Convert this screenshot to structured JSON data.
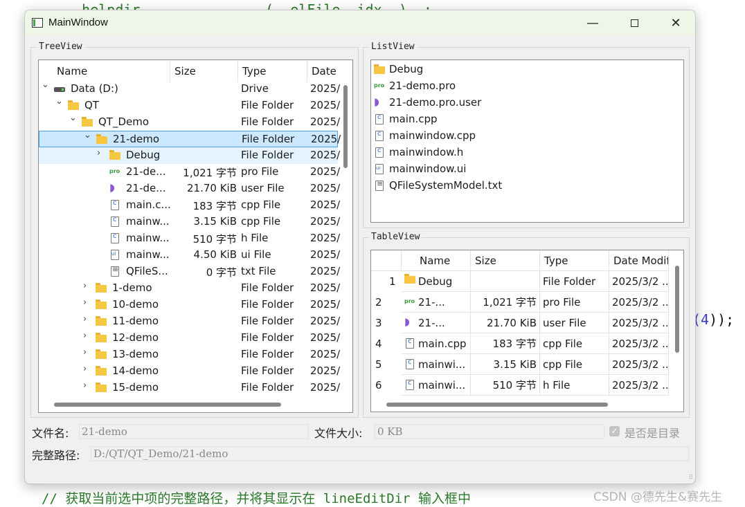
{
  "background": {
    "code_top": "    helpdir               (  elFile  idx  )  ;",
    "code_right_num": "(4",
    "code_right_rest": "));",
    "comment": "// 获取当前选中项的完整路径，并将其显示在 lineEditDir 输入框中",
    "watermark": "CSDN @德先生&赛先生"
  },
  "window": {
    "title": "MainWindow",
    "min_glyph": "—",
    "close_glyph": "✕"
  },
  "tree": {
    "group_title": "TreeView",
    "headers": [
      "Name",
      "Size",
      "Type",
      "Date"
    ],
    "rows": [
      {
        "name": "Data (D:)",
        "size": "",
        "type": "Drive",
        "date": "2025/",
        "chevron": "⌄",
        "icon": "drive-icon"
      },
      {
        "name": "QT",
        "size": "",
        "type": "File Folder",
        "date": "2025/",
        "chevron": "⌄",
        "icon": "folder-icon"
      },
      {
        "name": "QT_Demo",
        "size": "",
        "type": "File Folder",
        "date": "2025/",
        "chevron": "⌄",
        "icon": "folder-icon"
      },
      {
        "name": "21-demo",
        "size": "",
        "type": "File Folder",
        "date": "2025/",
        "chevron": "⌄",
        "icon": "folder-icon"
      },
      {
        "name": "Debug",
        "size": "",
        "type": "File Folder",
        "date": "2025/",
        "chevron": "›",
        "icon": "folder-icon"
      },
      {
        "name": "21-de...",
        "size": "1,021 字节",
        "type": "pro File",
        "date": "2025/",
        "chevron": "",
        "icon": "pro-icon"
      },
      {
        "name": "21-de...",
        "size": "21.70 KiB",
        "type": "user File",
        "date": "2025/",
        "chevron": "",
        "icon": "vs-icon"
      },
      {
        "name": "main.c...",
        "size": "183 字节",
        "type": "cpp File",
        "date": "2025/",
        "chevron": "",
        "icon": "cpp-icon"
      },
      {
        "name": "mainw...",
        "size": "3.15 KiB",
        "type": "cpp File",
        "date": "2025/",
        "chevron": "",
        "icon": "cpp-icon"
      },
      {
        "name": "mainw...",
        "size": "510 字节",
        "type": "h File",
        "date": "2025/",
        "chevron": "",
        "icon": "h-icon"
      },
      {
        "name": "mainw...",
        "size": "4.50 KiB",
        "type": "ui File",
        "date": "2025/",
        "chevron": "",
        "icon": "ui-icon"
      },
      {
        "name": "QFileS...",
        "size": "0 字节",
        "type": "txt File",
        "date": "2025/",
        "chevron": "",
        "icon": "txt-icon"
      },
      {
        "name": "1-demo",
        "size": "",
        "type": "File Folder",
        "date": "2025/",
        "chevron": "›",
        "icon": "folder-icon"
      },
      {
        "name": "10-demo",
        "size": "",
        "type": "File Folder",
        "date": "2025/",
        "chevron": "›",
        "icon": "folder-icon"
      },
      {
        "name": "11-demo",
        "size": "",
        "type": "File Folder",
        "date": "2025/",
        "chevron": "›",
        "icon": "folder-icon"
      },
      {
        "name": "12-demo",
        "size": "",
        "type": "File Folder",
        "date": "2025/",
        "chevron": "›",
        "icon": "folder-icon"
      },
      {
        "name": "13-demo",
        "size": "",
        "type": "File Folder",
        "date": "2025/",
        "chevron": "›",
        "icon": "folder-icon"
      },
      {
        "name": "14-demo",
        "size": "",
        "type": "File Folder",
        "date": "2025/",
        "chevron": "›",
        "icon": "folder-icon"
      },
      {
        "name": "15-demo",
        "size": "",
        "type": "File Folder",
        "date": "2025/",
        "chevron": "›",
        "icon": "folder-icon"
      }
    ]
  },
  "list": {
    "group_title": "ListView",
    "items": [
      {
        "label": "Debug",
        "icon": "folder-icon"
      },
      {
        "label": "21-demo.pro",
        "icon": "pro-icon"
      },
      {
        "label": "21-demo.pro.user",
        "icon": "vs-icon"
      },
      {
        "label": "main.cpp",
        "icon": "cpp-icon"
      },
      {
        "label": "mainwindow.cpp",
        "icon": "cpp-icon"
      },
      {
        "label": "mainwindow.h",
        "icon": "h-icon"
      },
      {
        "label": "mainwindow.ui",
        "icon": "ui-icon"
      },
      {
        "label": "QFileSystemModel.txt",
        "icon": "txt-icon"
      }
    ]
  },
  "table": {
    "group_title": "TableView",
    "headers": [
      "Name",
      "Size",
      "Type",
      "Date Modif"
    ],
    "rows": [
      {
        "num": "1",
        "name": "Debug",
        "size": "",
        "type": "File Folder",
        "date": "2025/3/2 ...",
        "icon": "folder-icon"
      },
      {
        "num": "2",
        "name": "21-...",
        "size": "1,021 字节",
        "type": "pro File",
        "date": "2025/3/2 ...",
        "icon": "pro-icon"
      },
      {
        "num": "3",
        "name": "21-...",
        "size": "21.70 KiB",
        "type": "user File",
        "date": "2025/3/2 ...",
        "icon": "vs-icon"
      },
      {
        "num": "4",
        "name": "main.cpp",
        "size": "183 字节",
        "type": "cpp File",
        "date": "2025/3/2 ...",
        "icon": "cpp-icon"
      },
      {
        "num": "5",
        "name": "mainwi...",
        "size": "3.15 KiB",
        "type": "cpp File",
        "date": "2025/3/2 ...",
        "icon": "cpp-icon"
      },
      {
        "num": "6",
        "name": "mainwi...",
        "size": "510 字节",
        "type": "h File",
        "date": "2025/3/2 ...",
        "icon": "h-icon"
      }
    ]
  },
  "fields": {
    "filename_label": "文件名:",
    "filename_value": "21-demo",
    "filesize_label": "文件大小:",
    "filesize_value": "0 KB",
    "isdir_label": "是否是目录",
    "isdir_checked": true,
    "fullpath_label": "完整路径:",
    "fullpath_value": "D:/QT/QT_Demo/21-demo"
  }
}
